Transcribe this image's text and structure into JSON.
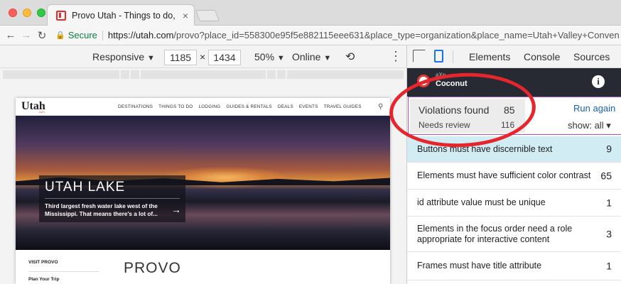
{
  "browser": {
    "tab_title": "Provo Utah - Things to do, Places",
    "tab_close_glyph": "×",
    "secure_label": "Secure",
    "url_host": "https://utah.com",
    "url_rest": "/provo?place_id=558300e95f5e882115eee631&place_type=organization&place_name=Utah+Valley+Conven"
  },
  "device_toolbar": {
    "mode": "Responsive",
    "width": "1185",
    "times": "×",
    "height": "1434",
    "zoom": "50%",
    "network": "Online",
    "dropdown_glyph": "▼"
  },
  "site": {
    "logo": "Utah",
    "logo_sub": ".com",
    "nav": [
      "DESTINATIONS",
      "THINGS TO DO",
      "LODGING",
      "GUIDES & RENTALS",
      "DEALS",
      "EVENTS",
      "TRAVEL GUIDES"
    ],
    "hero_title": "UTAH LAKE",
    "hero_desc": "Third largest fresh water lake west of the Mississippi. That means there's a lot of...",
    "hero_arrow": "→",
    "side_heading": "VISIT PROVO",
    "side_link": "Plan Your Trip",
    "page_heading": "PROVO"
  },
  "devtools": {
    "tabs": [
      "Elements",
      "Console",
      "Sources"
    ]
  },
  "coconut": {
    "small_label": "aXe",
    "name": "Coconut",
    "info_glyph": "i",
    "violations_label": "Violations found",
    "violations_count": "85",
    "review_label": "Needs review",
    "review_count": "116",
    "run_again": "Run again",
    "show_filter": "show: all ▾",
    "rules": [
      {
        "label": "Buttons must have discernible text",
        "count": "9",
        "selected": true
      },
      {
        "label": "Elements must have sufficient color contrast",
        "count": "65",
        "selected": false
      },
      {
        "label": "id attribute value must be unique",
        "count": "1",
        "selected": false
      },
      {
        "label": "Elements in the focus order need a role appropriate for interactive content",
        "count": "3",
        "selected": false
      },
      {
        "label": "Frames must have title attribute",
        "count": "1",
        "selected": false
      }
    ]
  },
  "colors": {
    "annotation": "#e6262c",
    "panel_header": "#272a33",
    "selected_row": "#d2ecf4",
    "summary_border": "#b44ec8",
    "link": "#1a5fb4"
  },
  "icons": [
    "close-icon",
    "back-arrow-icon",
    "forward-arrow-icon",
    "reload-icon",
    "lock-icon",
    "rotate-icon",
    "kebab-menu-icon",
    "inspect-icon",
    "device-icon",
    "info-icon",
    "search-icon"
  ]
}
